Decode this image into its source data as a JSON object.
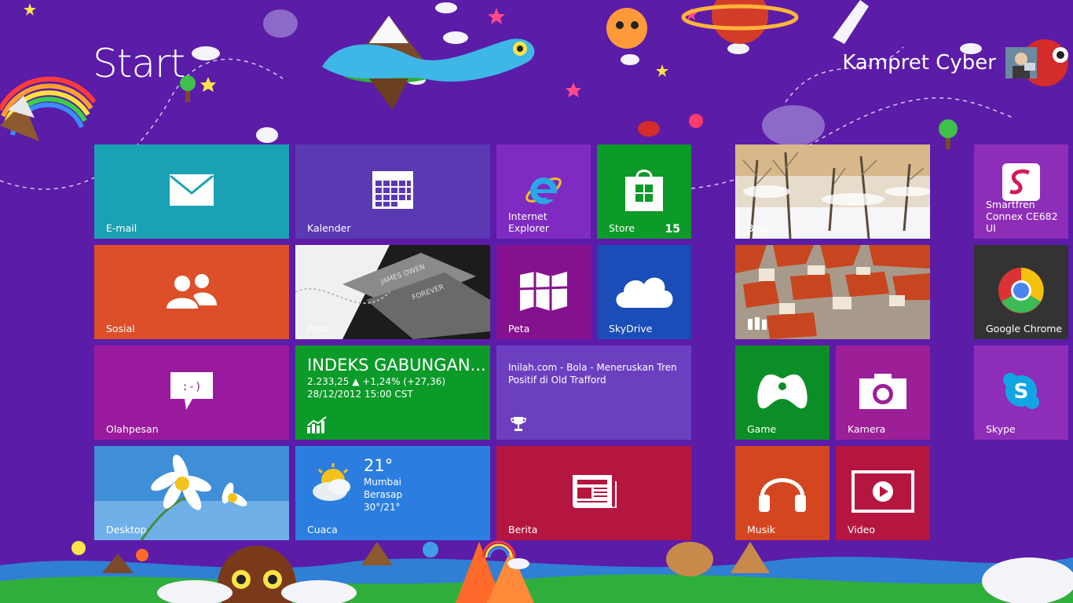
{
  "screen": {
    "title": "Start"
  },
  "user": {
    "name": "Kampret Cyber"
  },
  "tiles": {
    "email": {
      "label": "E-mail"
    },
    "kalender": {
      "label": "Kalender"
    },
    "ie": {
      "label": "Internet Explorer"
    },
    "store": {
      "label": "Store",
      "badge": "15"
    },
    "bing": {
      "label": "Bing"
    },
    "smartfren": {
      "label_line1": "Smartfren",
      "label_line2": "Connex CE682 UI"
    },
    "sosial": {
      "label": "Sosial"
    },
    "foto": {
      "label": "Foto"
    },
    "peta": {
      "label": "Peta"
    },
    "skydrive": {
      "label": "SkyDrive"
    },
    "chrome": {
      "label": "Google Chrome"
    },
    "olahpesan": {
      "label": "Olahpesan"
    },
    "finance": {
      "title": "INDEKS GABUNGAN...",
      "line1": "2.233,25 ▲ +1,24% (+27,36)",
      "line2": "28/12/2012 15:00 CST"
    },
    "sport": {
      "headline_line1": "Inilah.com - Bola - Meneruskan Tren",
      "headline_line2": "Positif di Old Trafford"
    },
    "game": {
      "label": "Game"
    },
    "kamera": {
      "label": "Kamera"
    },
    "skype": {
      "label": "Skype"
    },
    "desktop": {
      "label": "Desktop"
    },
    "cuaca": {
      "label": "Cuaca",
      "temp": "21°",
      "city": "Mumbai",
      "condition": "Berasap",
      "range": "30°/21°"
    },
    "berita": {
      "label": "Berita"
    },
    "musik": {
      "label": "Musik"
    },
    "video": {
      "label": "Video"
    }
  },
  "colors": {
    "background": "#5b1ca8",
    "email": "#1ba1b4",
    "kalender": "#5a39b5",
    "ie": "#7f2bc2",
    "store": "#0c9a28",
    "sosial": "#dc4f28",
    "peta": "#86118f",
    "skydrive": "#1a4db8",
    "chrome": "#333333",
    "olahpesan": "#9a1a9d",
    "finance": "#0c9a28",
    "sport": "#6c3fc0",
    "game": "#0c8e26",
    "kamera": "#9c1f98",
    "skype": "#8e2eb8",
    "cuaca": "#2b7ee0",
    "berita": "#b5163f",
    "musik": "#d4461f",
    "video": "#b5163f"
  }
}
